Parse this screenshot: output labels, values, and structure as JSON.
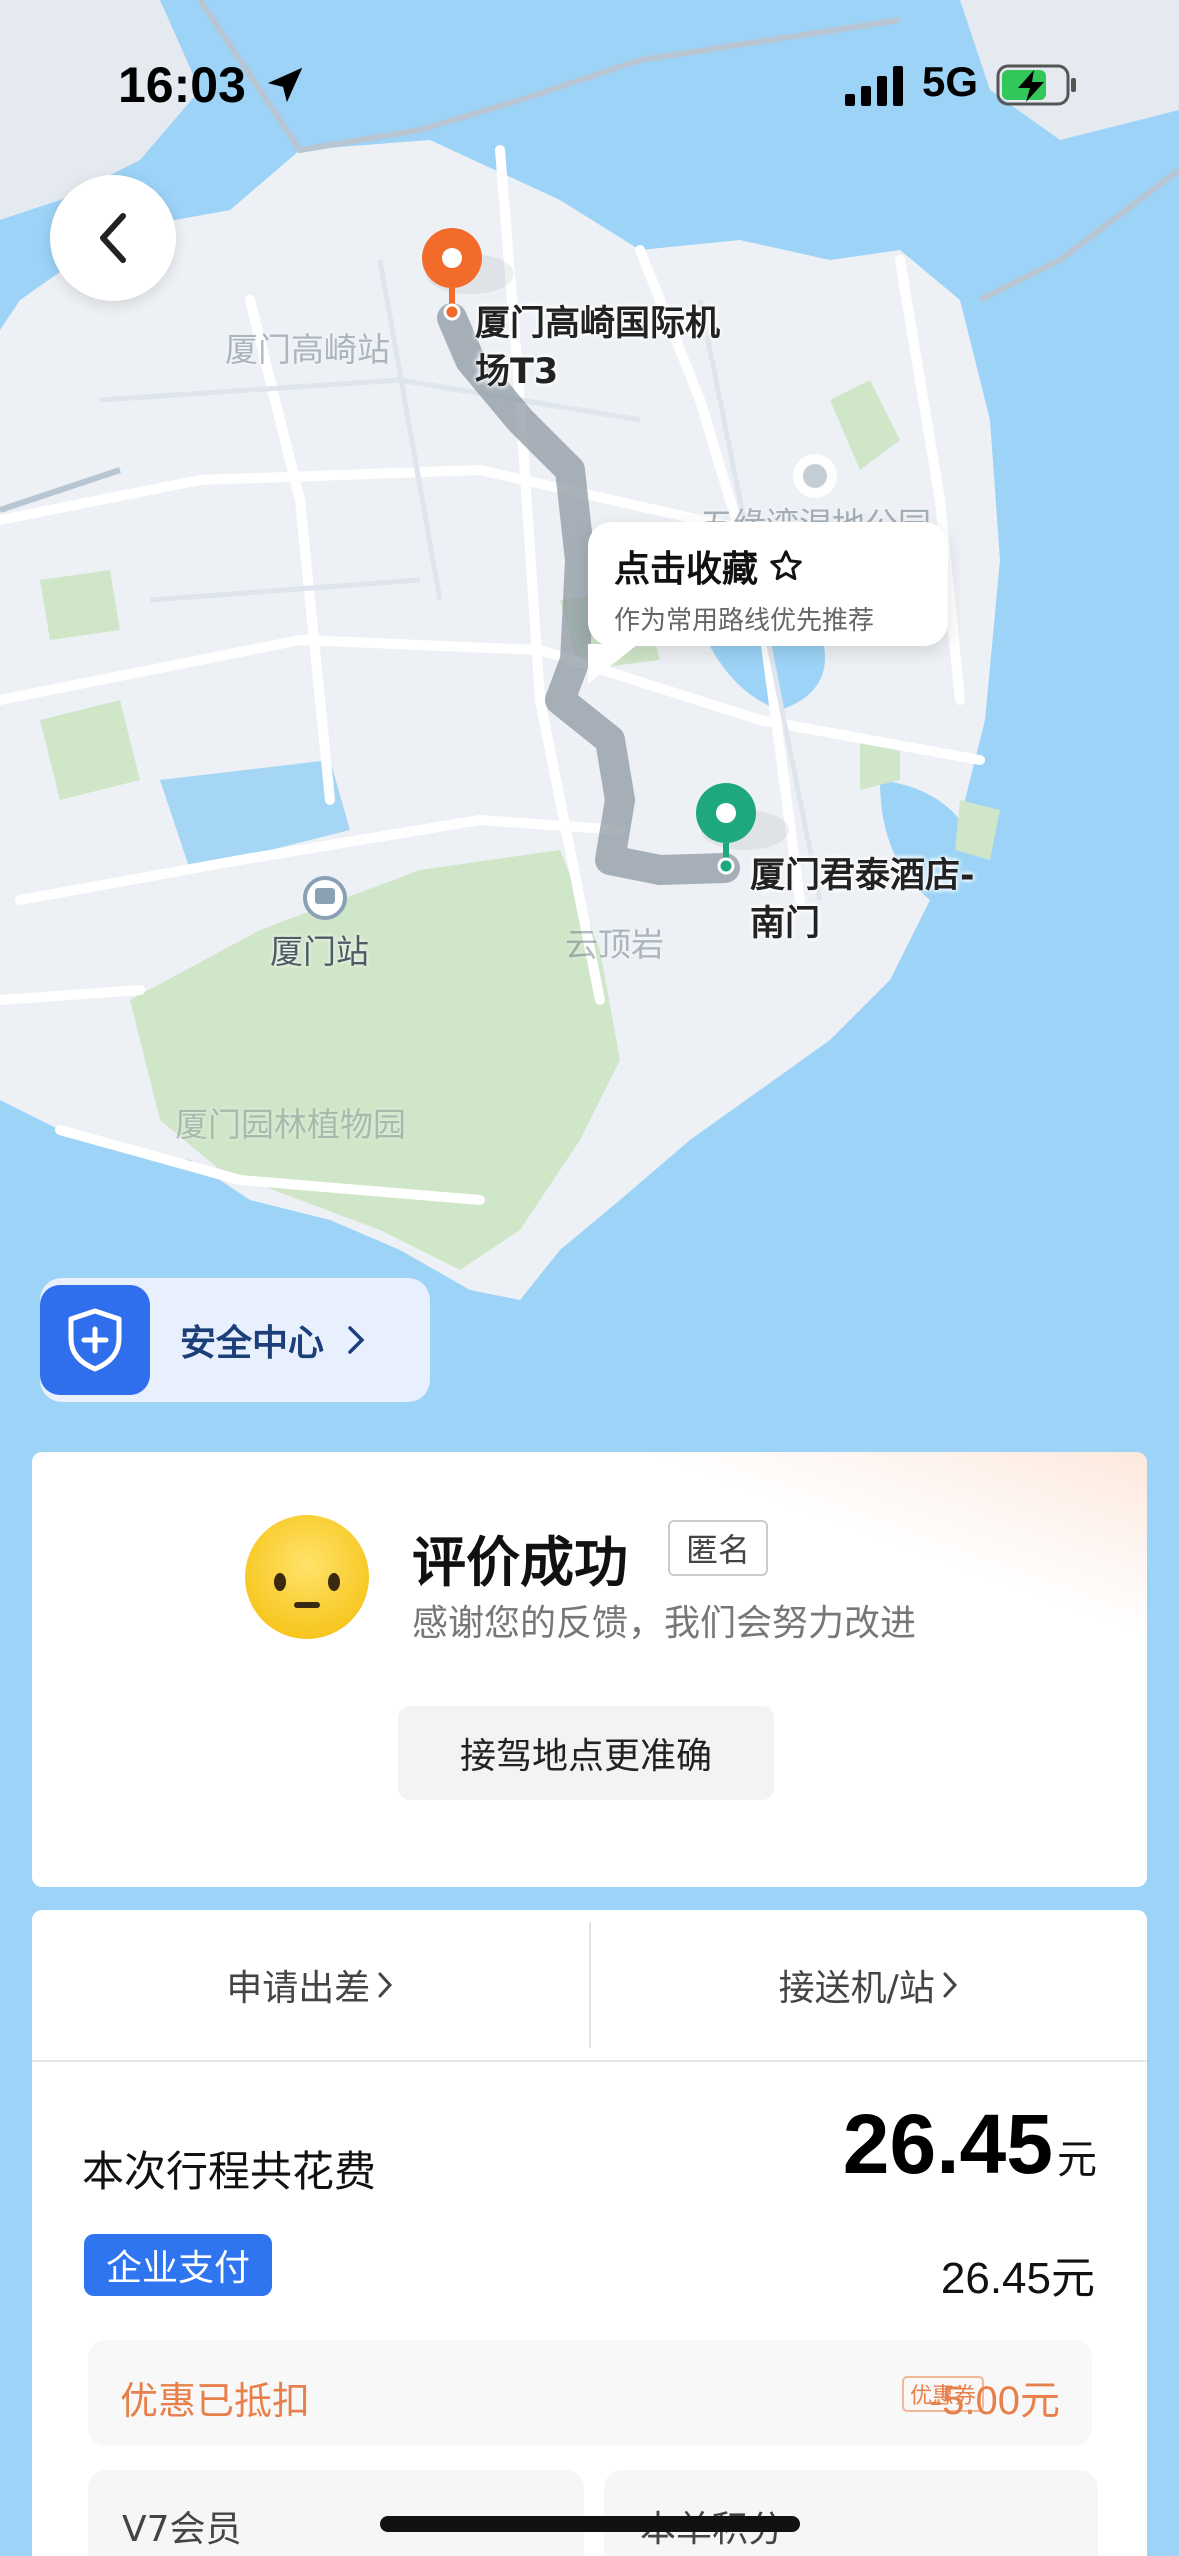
{
  "status_bar": {
    "time": "16:03",
    "network": "5G"
  },
  "map": {
    "origin_label": [
      "厦门高崎国际机",
      "场T3"
    ],
    "destination_label": [
      "厦门君泰酒店-",
      "南门"
    ],
    "station_label": "厦门站",
    "background_labels": [
      "厦门高崎站",
      "五缘湾湿地公园",
      "云顶岩",
      "厦门园林植物园"
    ],
    "origin_color": "#f26b2a",
    "destination_color": "#1fa87d"
  },
  "favorite_bubble": {
    "title": "点击收藏",
    "subtitle": "作为常用路线优先推荐"
  },
  "safety_center": {
    "label": "安全中心",
    "icon": "shield-plus-icon"
  },
  "review": {
    "title": "评价成功",
    "anonymous_badge": "匿名",
    "subtitle": "感谢您的反馈，我们会努力改进",
    "selected_tag": "接驾地点更准确",
    "emoji": "neutral-face"
  },
  "actions": {
    "business_trip": "申请出差",
    "airport_transfer": "接送机/站"
  },
  "fare": {
    "total_label": "本次行程共花费",
    "total_value": "26.45",
    "unit": "元",
    "payment_method": "企业支付",
    "payment_amount": "26.45元",
    "discount_label": "优惠已抵扣",
    "coupon_tag": "优惠券",
    "discount_amount": "-5.00元"
  },
  "membership": {
    "level_label": "V7会员",
    "points_label": "本单积分"
  },
  "colors": {
    "accent_blue": "#2f75f0",
    "discount_orange": "#e8804c",
    "water": "#9cd3f6",
    "land": "#edf1f5",
    "park": "#cfe6c8"
  }
}
